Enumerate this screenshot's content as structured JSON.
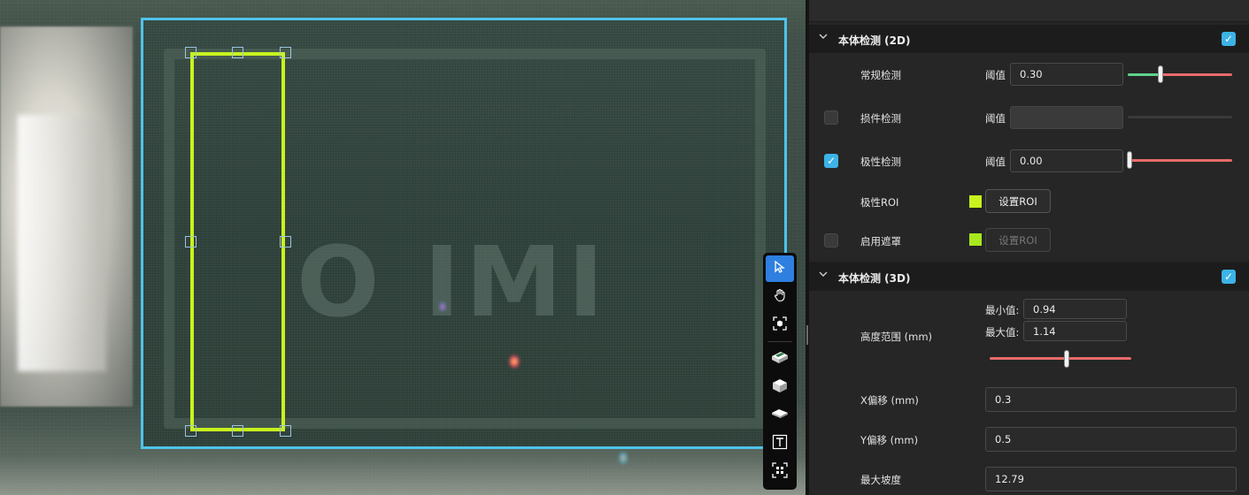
{
  "viewer": {
    "marking_text": "O IMI",
    "outer_roi_color": "#4fc3ea",
    "inner_roi_color": "#c8f31d"
  },
  "toolbar": {
    "tools": [
      {
        "name": "select-tool",
        "icon": "cursor-icon",
        "glyph": "⇖",
        "active": true
      },
      {
        "name": "pan-tool",
        "icon": "hand-icon",
        "glyph": "✋",
        "active": false
      },
      {
        "name": "fit-view-tool",
        "icon": "focus-box-icon",
        "glyph": "⛶",
        "active": false
      },
      {
        "name": "view-3d-front-tool",
        "icon": "component-3d-icon",
        "glyph": "▰",
        "active": false
      },
      {
        "name": "view-3d-side-tool",
        "icon": "cube-3d-icon",
        "glyph": "⬢",
        "active": false
      },
      {
        "name": "view-3d-flat-tool",
        "icon": "chip-flat-icon",
        "glyph": "⬬",
        "active": false
      },
      {
        "name": "text-tool",
        "icon": "text-icon",
        "glyph": "T",
        "active": false
      },
      {
        "name": "scan-tool",
        "icon": "qr-scan-icon",
        "glyph": "⌗",
        "active": false
      }
    ]
  },
  "panel": {
    "section_2d": {
      "title": "本体检测 (2D)",
      "enabled": true,
      "regular": {
        "label": "常规检测",
        "threshold_label": "阈值",
        "threshold_value": "0.30",
        "slider_fraction": 0.3
      },
      "damage": {
        "label": "损件检测",
        "threshold_label": "阈值",
        "threshold_value": "",
        "enabled": false
      },
      "polarity": {
        "label": "极性检测",
        "threshold_label": "阈值",
        "threshold_value": "0.00",
        "enabled": true,
        "slider_fraction": 0.0
      },
      "polarity_roi": {
        "label": "极性ROI",
        "button_label": "设置ROI",
        "swatch_color": "#c8f31d"
      },
      "mask": {
        "label": "启用遮罩",
        "button_label": "设置ROI",
        "swatch_color": "#a8e81e",
        "enabled": false
      }
    },
    "section_3d": {
      "title": "本体检测 (3D)",
      "enabled": true,
      "height_range": {
        "label": "高度范围 (mm)",
        "min_label": "最小值:",
        "min_value": "0.94",
        "max_label": "最大值:",
        "max_value": "1.14"
      },
      "x_offset": {
        "label": "X偏移 (mm)",
        "value": "0.3"
      },
      "y_offset": {
        "label": "Y偏移 (mm)",
        "value": "0.5"
      },
      "max_slope": {
        "label": "最大坡度",
        "value": "12.79"
      }
    },
    "colors": {
      "accent": "#3db3e6",
      "slider_low": "#5fd38a",
      "slider_high": "#e86a6a"
    }
  }
}
